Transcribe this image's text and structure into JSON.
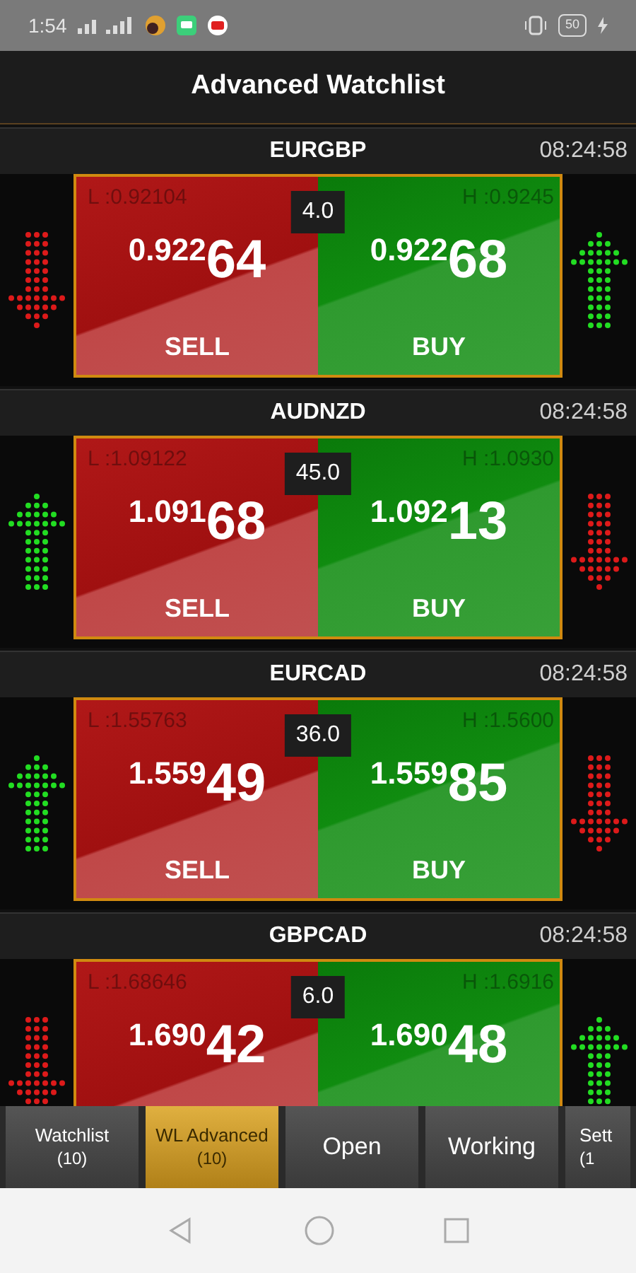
{
  "status_bar": {
    "time": "1:54",
    "battery": "50"
  },
  "header": {
    "title": "Advanced Watchlist"
  },
  "cards": [
    {
      "symbol": "EURGBP",
      "time": "08:24:58",
      "low": "L :0.92104",
      "high": "H :0.9245",
      "spread": "4.0",
      "sell": {
        "prefix": "0.922",
        "pips": "64",
        "label": "SELL"
      },
      "buy": {
        "prefix": "0.922",
        "pips": "68",
        "label": "BUY"
      },
      "left_arrow": {
        "kind": "down"
      },
      "right_arrow": {
        "kind": "up"
      }
    },
    {
      "symbol": "AUDNZD",
      "time": "08:24:58",
      "low": "L :1.09122",
      "high": "H :1.0930",
      "spread": "45.0",
      "sell": {
        "prefix": "1.091",
        "pips": "68",
        "label": "SELL"
      },
      "buy": {
        "prefix": "1.092",
        "pips": "13",
        "label": "BUY"
      },
      "left_arrow": {
        "kind": "up"
      },
      "right_arrow": {
        "kind": "down"
      }
    },
    {
      "symbol": "EURCAD",
      "time": "08:24:58",
      "low": "L :1.55763",
      "high": "H :1.5600",
      "spread": "36.0",
      "sell": {
        "prefix": "1.559",
        "pips": "49",
        "label": "SELL"
      },
      "buy": {
        "prefix": "1.559",
        "pips": "85",
        "label": "BUY"
      },
      "left_arrow": {
        "kind": "up"
      },
      "right_arrow": {
        "kind": "down"
      }
    },
    {
      "symbol": "GBPCAD",
      "time": "08:24:58",
      "low": "L :1.68646",
      "high": "H :1.6916",
      "spread": "6.0",
      "sell": {
        "prefix": "1.690",
        "pips": "42"
      },
      "buy": {
        "prefix": "1.690",
        "pips": "48"
      },
      "left_arrow": {
        "kind": "down"
      },
      "right_arrow": {
        "kind": "up"
      }
    }
  ],
  "tabs": [
    {
      "label": "Watchlist",
      "count": "(10)",
      "selected": false
    },
    {
      "label": "WL Advanced",
      "count": "(10)",
      "selected": true
    },
    {
      "label": "Open",
      "selected": false
    },
    {
      "label": "Working",
      "selected": false
    },
    {
      "label": "Sett",
      "count": "(1",
      "selected": false
    }
  ]
}
